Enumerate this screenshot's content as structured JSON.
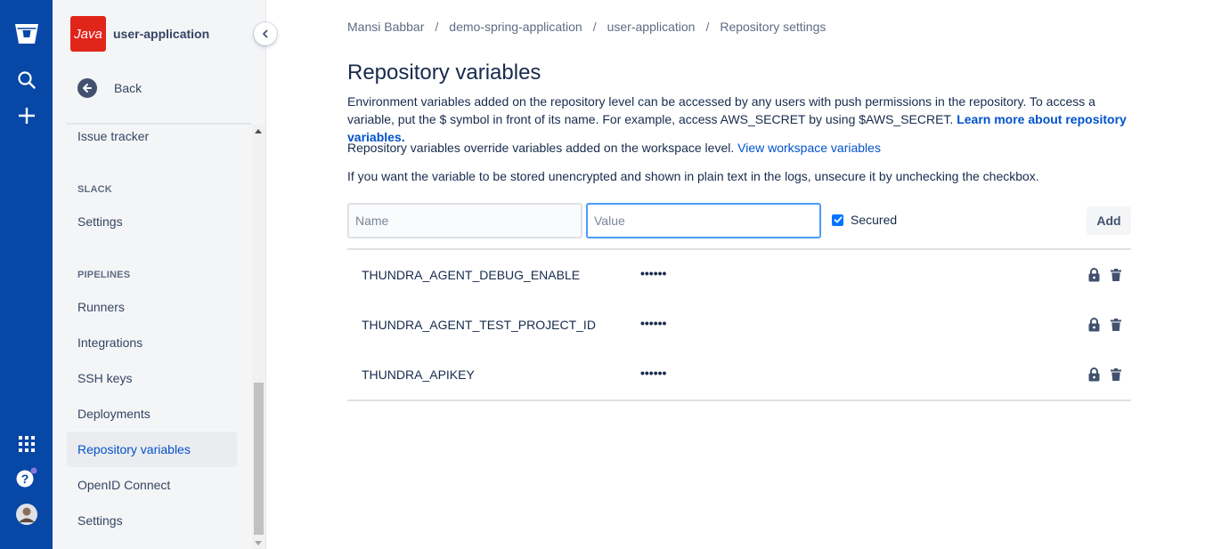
{
  "global_nav": {
    "icons": [
      "bitbucket-logo-icon",
      "search-icon",
      "create-plus-icon",
      "app-switcher-icon",
      "help-icon",
      "profile-avatar"
    ]
  },
  "sidebar": {
    "repo_avatar_text": "Java",
    "repo_name": "user-application",
    "back_label": "Back",
    "items": {
      "issue_tracker": "Issue tracker",
      "slack_section": "SLACK",
      "slack_settings": "Settings",
      "pipelines_section": "PIPELINES",
      "runners": "Runners",
      "integrations": "Integrations",
      "ssh_keys": "SSH keys",
      "deployments": "Deployments",
      "repository_variables": "Repository variables",
      "openid_connect": "OpenID Connect",
      "pipelines_settings": "Settings"
    },
    "selected": "Repository variables"
  },
  "breadcrumbs": [
    "Mansi Babbar",
    "demo-spring-application",
    "user-application",
    "Repository settings"
  ],
  "breadcrumb_separator": "/",
  "page": {
    "title": "Repository variables",
    "desc1": "Environment variables added on the repository level can be accessed by any users with push permissions in the repository. To access a variable, put the $ symbol in front of its name. For example, access AWS_SECRET by using $AWS_SECRET.",
    "desc1_link": "Learn more about repository variables.",
    "desc2": "Repository variables override variables added on the workspace level.",
    "desc2_link": "View workspace variables",
    "desc3": "If you want the variable to be stored unencrypted and shown in plain text in the logs, unsecure it by unchecking the checkbox."
  },
  "form": {
    "name_placeholder": "Name",
    "value_placeholder": "Value",
    "secured_label": "Secured",
    "secured_checked": true,
    "add_label": "Add"
  },
  "variables": [
    {
      "name": "THUNDRA_AGENT_DEBUG_ENABLE",
      "value": "••••••"
    },
    {
      "name": "THUNDRA_AGENT_TEST_PROJECT_ID",
      "value": "••••••"
    },
    {
      "name": "THUNDRA_APIKEY",
      "value": "••••••"
    }
  ],
  "colors": {
    "global_nav": "#0747a6",
    "link": "#0052cc",
    "sidebar_bg": "#f4f5f7",
    "repo_avatar": "#e1251b"
  }
}
